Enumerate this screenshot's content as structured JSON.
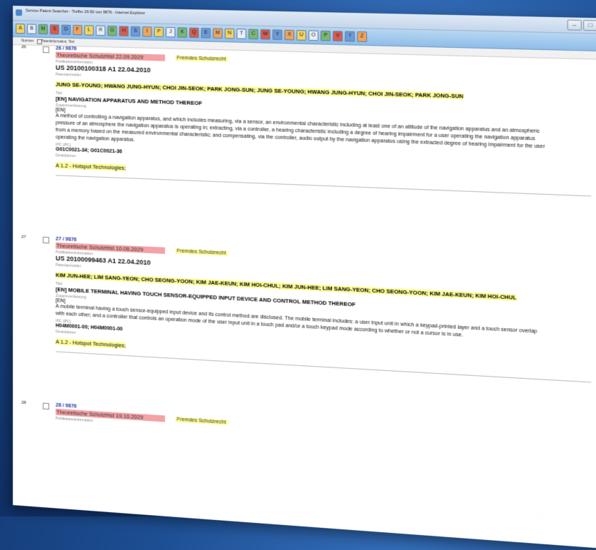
{
  "window": {
    "title": "Service Patent Searcher - Treffer 26-50 von 9876 - Internet Explorer"
  },
  "toolbar": {
    "buttons": [
      "A",
      "B",
      "M",
      "S",
      "D",
      "F",
      "L",
      "R",
      "G",
      "H",
      "S",
      "I",
      "P",
      "J",
      "K",
      "Q",
      "E",
      "M",
      "N",
      "T",
      "C",
      "W",
      "Y",
      "X",
      "U",
      "O",
      "P",
      "V",
      "?",
      "Z"
    ]
  },
  "columns": {
    "number": "Nummer",
    "info": "Patentinformation, Titel"
  },
  "labels": {
    "publication": "Publikationsinformation",
    "applicant": "Patentanmelder",
    "title": "Titel",
    "abstract": "Zusammenfassung",
    "ipc": "IPC (IPC)",
    "descriptors": "Deskriptoren"
  },
  "records": [
    {
      "row": "26",
      "hit": "26 / 9876",
      "protection": "Theoretische Schutzfrist 22.09.2029",
      "foreign": "Fremdes Schutzrecht",
      "publication": "US 20100100318 A1 22.04.2010",
      "applicants": "JUNG SE-YOUNG; HWANG JUNG-HYUN; CHOI JIN-SEOK; PARK JONG-SUN; JUNG SE-YOUNG; HWANG JUNG-HYUN; CHOI JIN-SEOK; PARK JONG-SUN",
      "title": "[EN] NAVIGATION APPARATUS AND METHOD THEREOF",
      "lang": "[EN]",
      "abstract": "A method of controlling a navigation apparatus, and which includes measuring, via a sensor, an environmental characteristic including at least one of an altitude of the navigation apparatus and an atmospheric pressure of an atmosphere the navigation apparatus is operating in; extracting, via a controller, a hearing characteristic including a degree of hearing impairment for a user operating the navigation apparatus from a memory based on the measured environmental characteristic; and compensating, via the controller, audio output by the navigation apparatus using the extracted degree of hearing impairment for the user operating the navigation apparatus.",
      "ipc": "G01C0021-34; G01C0021-36",
      "descriptors": "A 1.2 - Hotspot Technologies;"
    },
    {
      "row": "27",
      "hit": "27 / 9876",
      "protection": "Theoretische Schutzfrist 10.06.2029",
      "foreign": "Fremdes Schutzrecht",
      "publication": "US 20100099463 A1 22.04.2010",
      "applicants": "KIM JUN-HEE; LIM SANG-YEON; CHO SEONG-YOON; KIM JAE-KEUN; KIM HOI-CHUL; KIM JUN-HEE; LIM SANG-YEON; CHO SEONG-YOON; KIM JAE-KEUN; KIM HOI-CHUL",
      "title": "[EN] MOBILE TERMINAL HAVING TOUCH SENSOR-EQUIPPED INPUT DEVICE AND CONTROL METHOD THEREOF",
      "lang": "[EN]",
      "abstract": "A mobile terminal having a touch sensor-equipped input device and its control method are disclosed. The mobile terminal includes: a user input unit in which a keypad-printed layer and a touch sensor overlap with each other; and a controller that controls an operation mode of the user input unit in a touch pad and/or a touch keypad mode according to whether or not a cursor is in use.",
      "ipc": "H04M0001-00; H04M0001-00",
      "descriptors": "A 1.2 - Hotspot Technologies;"
    },
    {
      "row": "28",
      "hit": "28 / 9876",
      "protection": "Theoretische Schutzfrist 19.10.2029",
      "foreign": "Fremdes Schutzrecht"
    }
  ]
}
